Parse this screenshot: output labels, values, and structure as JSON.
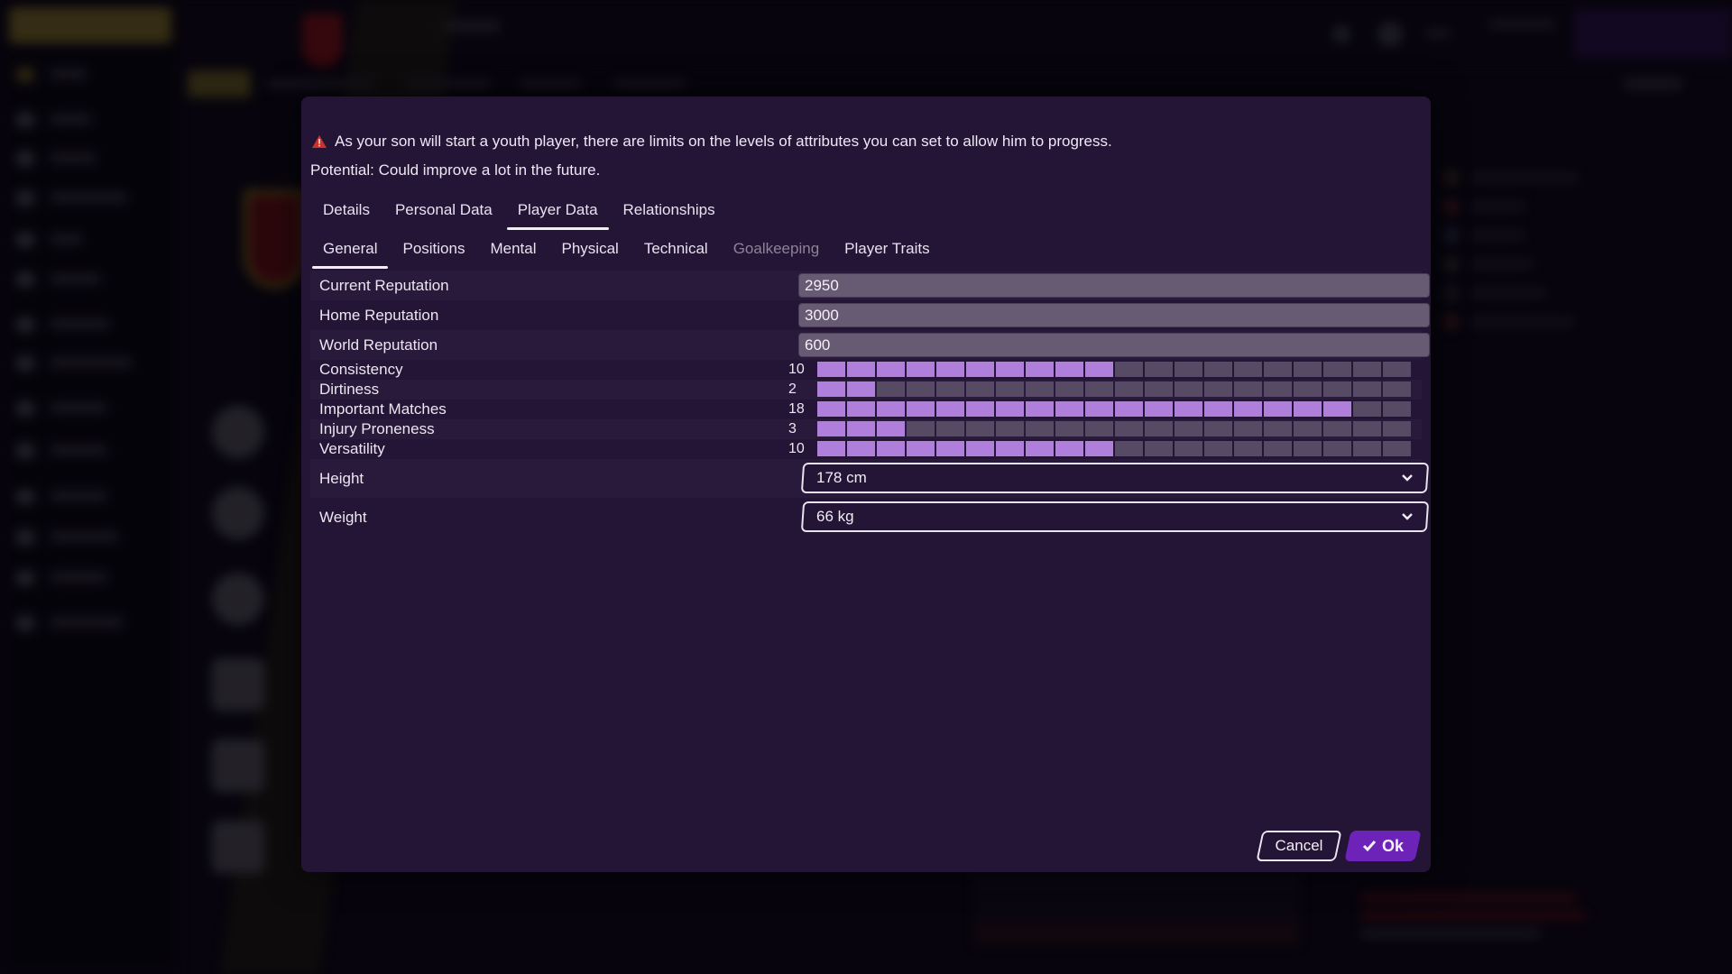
{
  "dialog": {
    "warning_icon": "warning-triangle-icon",
    "warning_text": "As your son will start a youth player, there are limits on the levels of attributes you can set to allow him to progress.",
    "potential_text": "Potential: Could improve a lot in the future.",
    "main_tabs": [
      {
        "label": "Details",
        "active": false
      },
      {
        "label": "Personal Data",
        "active": false
      },
      {
        "label": "Player Data",
        "active": true
      },
      {
        "label": "Relationships",
        "active": false
      }
    ],
    "sub_tabs": [
      {
        "label": "General",
        "active": true,
        "disabled": false
      },
      {
        "label": "Positions",
        "active": false,
        "disabled": false
      },
      {
        "label": "Mental",
        "active": false,
        "disabled": false
      },
      {
        "label": "Physical",
        "active": false,
        "disabled": false
      },
      {
        "label": "Technical",
        "active": false,
        "disabled": false
      },
      {
        "label": "Goalkeeping",
        "active": false,
        "disabled": true
      },
      {
        "label": "Player Traits",
        "active": false,
        "disabled": false
      }
    ],
    "reputation": [
      {
        "label": "Current Reputation",
        "value": "2950"
      },
      {
        "label": "Home Reputation",
        "value": "3000"
      },
      {
        "label": "World Reputation",
        "value": "600"
      }
    ],
    "attribute_max": 20,
    "attributes": [
      {
        "label": "Consistency",
        "value": 10
      },
      {
        "label": "Dirtiness",
        "value": 2
      },
      {
        "label": "Important Matches",
        "value": 18
      },
      {
        "label": "Injury Proneness",
        "value": 3
      },
      {
        "label": "Versatility",
        "value": 10
      }
    ],
    "selects": [
      {
        "label": "Height",
        "value": "178 cm",
        "icon": "chevron-down-icon"
      },
      {
        "label": "Weight",
        "value": "66 kg",
        "icon": "chevron-down-icon"
      }
    ],
    "buttons": {
      "cancel_label": "Cancel",
      "ok_label": "Ok",
      "ok_icon": "checkmark-icon"
    }
  },
  "colors": {
    "dialog_bg": "#241436",
    "bar_filled": "#b07edb",
    "bar_empty": "#574a64",
    "ok_button": "#6d22b8",
    "warning": "#d0302a"
  }
}
